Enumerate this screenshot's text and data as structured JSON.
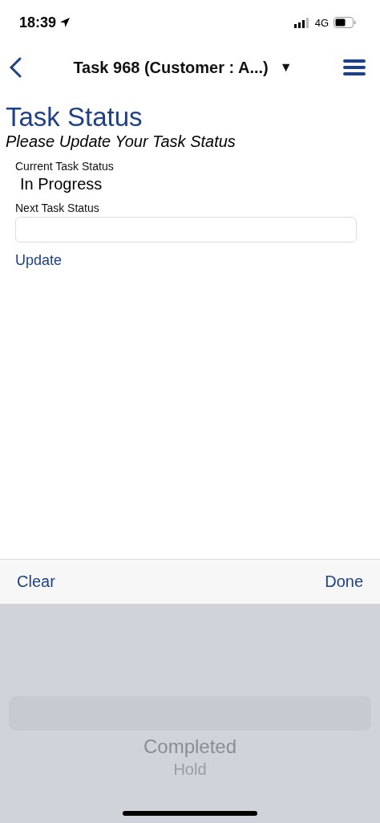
{
  "status_bar": {
    "time": "18:39",
    "network": "4G"
  },
  "nav_bar": {
    "title": "Task 968 (Customer : A...)",
    "dropdown": "▼"
  },
  "page": {
    "title": "Task Status",
    "subtitle": "Please Update Your Task Status",
    "current_label": "Current Task Status",
    "current_value": "In Progress",
    "next_label": "Next Task Status",
    "update_link": "Update"
  },
  "picker": {
    "clear": "Clear",
    "done": "Done",
    "options": [
      {
        "label": "Completed"
      },
      {
        "label": "Hold"
      }
    ]
  }
}
